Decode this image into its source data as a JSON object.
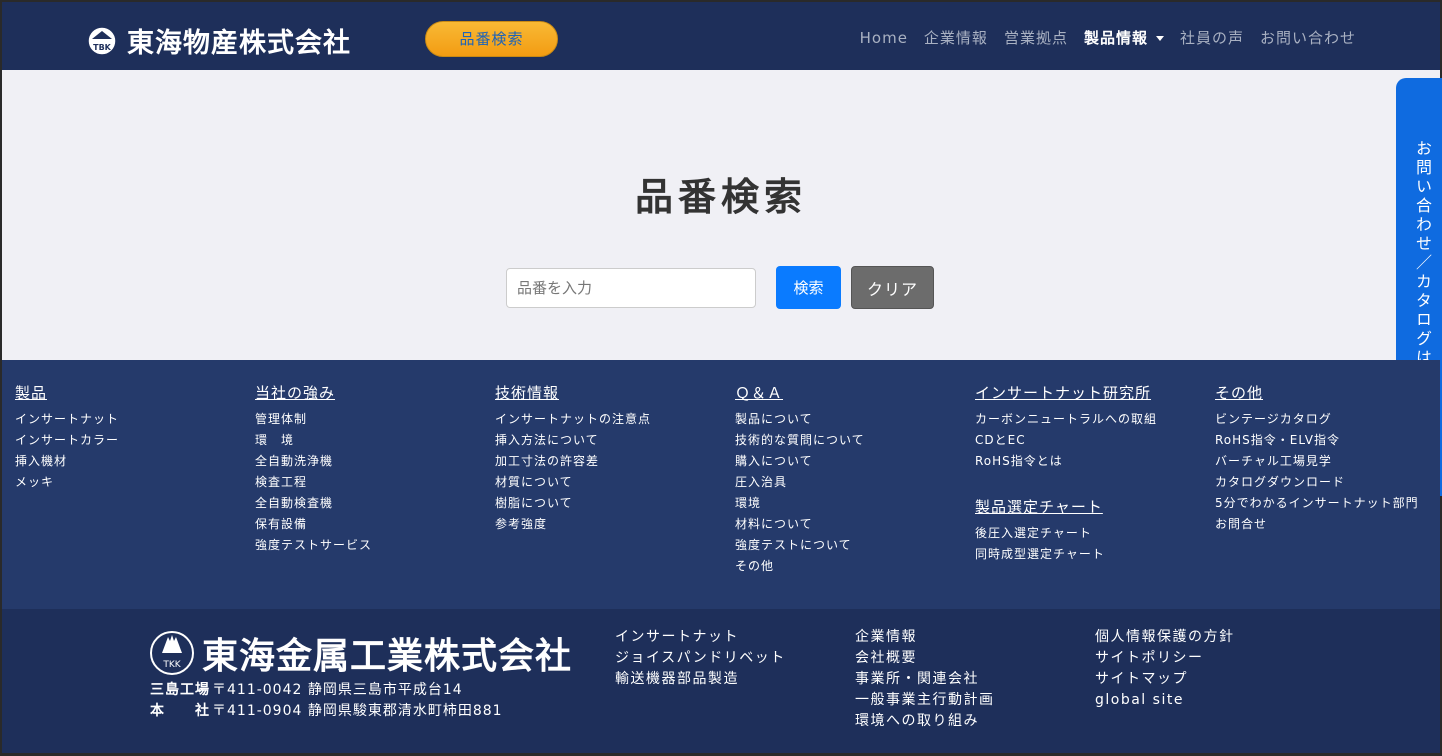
{
  "header": {
    "logo_mark": "TBK",
    "company": "東海物産株式会社",
    "search_pill": "品番検索",
    "nav": [
      {
        "label": "Home"
      },
      {
        "label": "企業情報"
      },
      {
        "label": "営業拠点"
      },
      {
        "label": "製品情報"
      },
      {
        "label": "社員の声"
      },
      {
        "label": "お問い合わせ"
      }
    ]
  },
  "main": {
    "title": "品番検索",
    "input_placeholder": "品番を入力",
    "search_button": "検索",
    "clear_button": "クリア"
  },
  "side_tab": "お問い合わせ／カタログはこちら",
  "footer_links": {
    "columns": [
      {
        "heading": "製品",
        "items": [
          "インサートナット",
          "インサートカラー",
          "挿入機材",
          "メッキ"
        ]
      },
      {
        "heading": "当社の強み",
        "items": [
          "管理体制",
          "環　境",
          "全自動洗浄機",
          "検査工程",
          "全自動検査機",
          "保有設備",
          "強度テストサービス"
        ]
      },
      {
        "heading": "技術情報",
        "items": [
          "インサートナットの注意点",
          "挿入方法について",
          "加工寸法の許容差",
          "材質について",
          "樹脂について",
          "参考強度"
        ]
      },
      {
        "heading": "Ｑ＆Ａ",
        "items": [
          "製品について",
          "技術的な質問について",
          "購入について",
          "圧入治具",
          "環境",
          "材料について",
          "強度テストについて",
          "その他"
        ]
      },
      {
        "heading": "インサートナット研究所",
        "items": [
          "カーボンニュートラルへの取組",
          "CDとEC",
          "RoHS指令とは"
        ],
        "sub_heading": "製品選定チャート",
        "sub_items": [
          "後圧入選定チャート",
          "同時成型選定チャート"
        ]
      },
      {
        "heading": "その他",
        "items": [
          "ビンテージカタログ",
          "RoHS指令・ELV指令",
          "バーチャル工場見学",
          "カタログダウンロード",
          "5分でわかるインサートナット部門",
          "お問合せ"
        ]
      }
    ]
  },
  "footer_bottom": {
    "logo_mark": "TKK",
    "company": "東海金属工業株式会社",
    "addresses": [
      {
        "label": "三島工場",
        "text": "〒411-0042 静岡県三島市平成台14"
      },
      {
        "label": "本　　社",
        "text": "〒411-0904 静岡県駿東郡清水町柿田881"
      }
    ],
    "col1": [
      "インサートナット",
      "ジョイスパンドリベット",
      "輸送機器部品製造"
    ],
    "col2": [
      "企業情報",
      "会社概要",
      "事業所・関連会社",
      "一般事業主行動計画",
      "環境への取り組み"
    ],
    "col3": [
      "個人情報保護の方針",
      "サイトポリシー",
      "サイトマップ",
      "global site"
    ]
  }
}
